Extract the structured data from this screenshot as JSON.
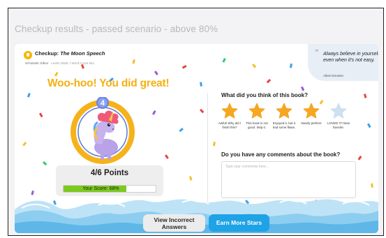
{
  "frame_title": "Checkup results - passed scenario - above 80%",
  "book": {
    "label": "Checkup:",
    "title": "The Moon Speech",
    "publisher": "Scholastic Editor",
    "lexile": "Lexile 1550L",
    "word_count": "/ Word Count 661"
  },
  "quote": {
    "mark": "“",
    "text": "Always believe in yourself even when it's not easy.",
    "author": "Albert Einstein"
  },
  "result": {
    "headline": "Woo-hoo! You did great!",
    "badge_number": "4",
    "points": "4/6 Points",
    "score_label": "Your Score: 68%",
    "score_percent": 68
  },
  "rating": {
    "question": "What did you think of this book?",
    "selected": 4,
    "options": [
      {
        "caption": "Awful! Why did I finish this?"
      },
      {
        "caption": "This book is not good. Skip it."
      },
      {
        "caption": "Enjoyed it, but it had some flaws."
      },
      {
        "caption": "Nearly perfect!"
      },
      {
        "caption": "LOVED IT! New favorite."
      }
    ]
  },
  "comments": {
    "question": "Do you have any comments about the book?",
    "placeholder": "Type your comments here...",
    "value": ""
  },
  "actions": {
    "view_incorrect": "View Incorrect Answers",
    "earn_stars": "Earn More Stars"
  },
  "colors": {
    "accent_yellow": "#f5b012",
    "star_filled": "#f5a623",
    "star_empty": "#cfe0ef",
    "progress_green": "#7cc91f",
    "primary_button": "#1fa2e6",
    "quote_bg": "#e7eef6",
    "ring_blue": "#5a79d9"
  }
}
